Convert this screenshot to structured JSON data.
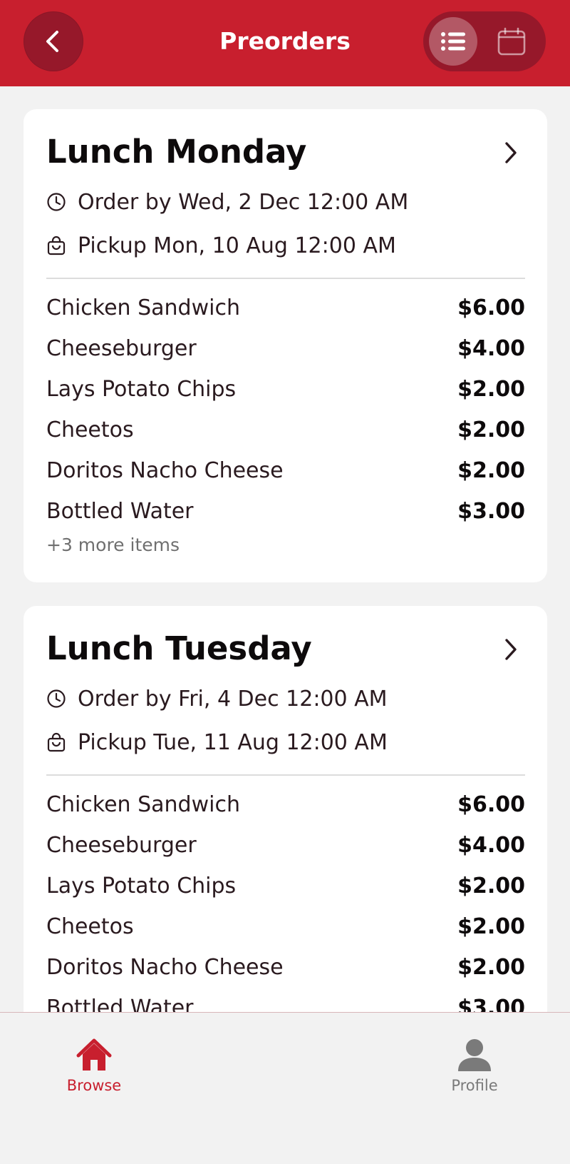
{
  "header": {
    "title": "Preorders",
    "back_icon": "chevron-left-icon",
    "list_view_icon": "list-icon",
    "calendar_view_icon": "calendar-icon"
  },
  "colors": {
    "brand": "#c81f2e",
    "brand_dark": "#96182a",
    "background": "#f2f2f2",
    "card": "#ffffff"
  },
  "cards": [
    {
      "title": "Lunch Monday",
      "order_by": "Order by Wed, 2 Dec 12:00 AM",
      "pickup": "Pickup Mon, 10 Aug 12:00 AM",
      "items": [
        {
          "name": "Chicken Sandwich",
          "price": "$6.00"
        },
        {
          "name": "Cheeseburger",
          "price": "$4.00"
        },
        {
          "name": "Lays Potato Chips",
          "price": "$2.00"
        },
        {
          "name": "Cheetos",
          "price": "$2.00"
        },
        {
          "name": "Doritos Nacho Cheese",
          "price": "$2.00"
        },
        {
          "name": "Bottled Water",
          "price": "$3.00"
        }
      ],
      "more": "+3 more items"
    },
    {
      "title": "Lunch Tuesday",
      "order_by": "Order by Fri, 4 Dec 12:00 AM",
      "pickup": "Pickup Tue, 11 Aug 12:00 AM",
      "items": [
        {
          "name": "Chicken Sandwich",
          "price": "$6.00"
        },
        {
          "name": "Cheeseburger",
          "price": "$4.00"
        },
        {
          "name": "Lays Potato Chips",
          "price": "$2.00"
        },
        {
          "name": "Cheetos",
          "price": "$2.00"
        },
        {
          "name": "Doritos Nacho Cheese",
          "price": "$2.00"
        },
        {
          "name": "Bottled Water",
          "price": "$3.00"
        }
      ]
    }
  ],
  "tabbar": {
    "browse_label": "Browse",
    "browse_icon": "home-icon",
    "profile_label": "Profile",
    "profile_icon": "person-icon"
  }
}
